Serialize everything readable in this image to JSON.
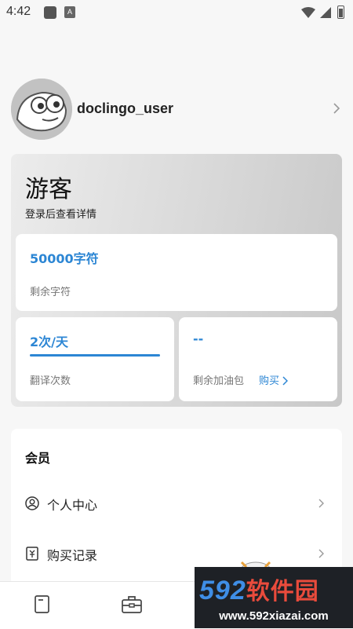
{
  "status_bar": {
    "time": "4:42",
    "notif_letter": "A"
  },
  "profile": {
    "username": "doclingo_user"
  },
  "guest": {
    "title": "游客",
    "subtitle": "登录后查看详情",
    "chars_value": "50000字符",
    "chars_label": "剩余字符",
    "translations_value": "2次/天",
    "translations_label": "翻译次数",
    "translations_progress": 1.0,
    "fuel_value": "--",
    "fuel_label": "剩余加油包",
    "buy_label": "购买"
  },
  "member": {
    "title": "会员",
    "items": [
      {
        "label": "个人中心",
        "icon": "user-circle-icon"
      },
      {
        "label": "购买记录",
        "icon": "receipt-icon"
      }
    ]
  },
  "bottom_nav": {
    "items": [
      "document-icon",
      "toolbox-icon"
    ]
  },
  "watermark": {
    "brand_digits": "592",
    "brand_text": "软件园",
    "url": "www.592xiazai.com"
  },
  "colors": {
    "accent": "#2c86d4",
    "background": "#f7f7f7"
  }
}
